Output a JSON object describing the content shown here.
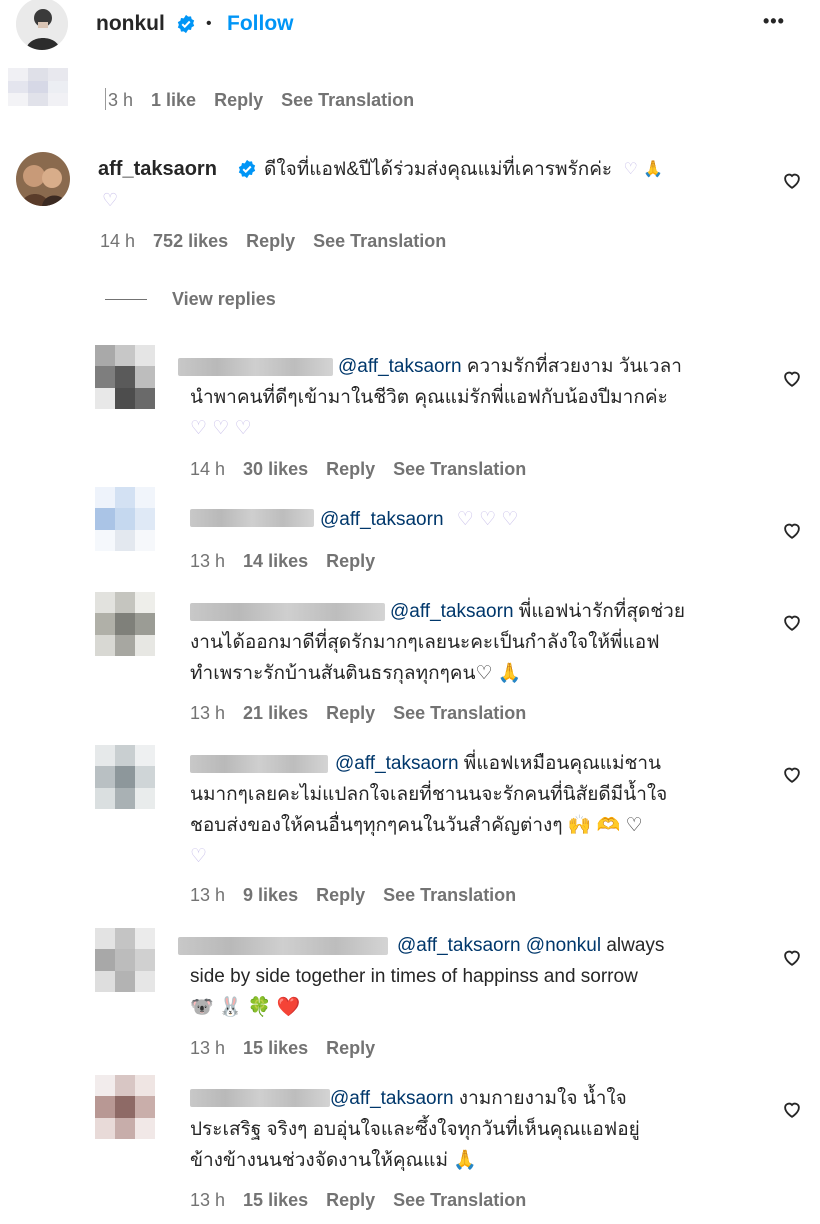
{
  "header": {
    "username": "nonkul",
    "separator": "•",
    "follow_label": "Follow",
    "more_label": "•••"
  },
  "top_comment": {
    "time": "3 h",
    "likes": "1 like",
    "reply": "Reply",
    "translate": "See Translation"
  },
  "main_comment": {
    "username": "aff_taksaorn",
    "text": "ดีใจที่แอฟ&ปีได้ร่วมส่งคุณแม่ที่เคารพรักค่ะ",
    "emoji1": "♡",
    "emoji2": "🙏",
    "emoji3": "♡",
    "time": "14 h",
    "likes": "752 likes",
    "reply": "Reply",
    "translate": "See Translation",
    "view_replies": "View replies"
  },
  "replies": [
    {
      "mention": "@aff_taksaorn",
      "line1": "ความรักที่สวยงาม วันเวลา",
      "line2": "นำพาคนที่ดีๆเข้ามาในชีวิต คุณแม่รักพี่แอฟกับน้องปีมากค่ะ",
      "line3": "♡ ♡ ♡",
      "time": "14 h",
      "likes": "30 likes",
      "reply": "Reply",
      "translate": "See Translation"
    },
    {
      "mention": "@aff_taksaorn",
      "line1": "♡ ♡ ♡",
      "time": "13 h",
      "likes": "14 likes",
      "reply": "Reply"
    },
    {
      "mention": "@aff_taksaorn",
      "line1": "พี่แอฟน่ารักที่สุดช่วย",
      "line2": "งานได้ออกมาดีที่สุดรักมากๆเลยนะคะเป็นกำลังใจให้พี่แอฟ",
      "line3": "ทำเพราะรักบ้านสันตินธรกุลทุกๆคน♡ 🙏",
      "time": "13 h",
      "likes": "21 likes",
      "reply": "Reply",
      "translate": "See Translation"
    },
    {
      "mention": "@aff_taksaorn",
      "line1": "พี่แอฟเหมือนคุณแม่ชาน",
      "line2": "นมากๆเลยคะไม่แปลกใจเลยที่ชานนจะรักคนที่นิสัยดีมีน้ำใจ",
      "line3": "ชอบส่งของให้คนอื่นๆทุกๆคนในวันสำคัญต่างๆ 🙌 🫶 ♡",
      "line4": "♡",
      "time": "13 h",
      "likes": "9 likes",
      "reply": "Reply",
      "translate": "See Translation"
    },
    {
      "mention": "@aff_taksaorn @nonkul",
      "line1": "always",
      "line2": "side by side together in times of happinss and sorrow",
      "line3": "🐨 🐰 🍀 ❤️",
      "time": "13 h",
      "likes": "15 likes",
      "reply": "Reply"
    },
    {
      "mention": "@aff_taksaorn",
      "line1": "งามกายงามใจ น้ำใจ",
      "line2": "ประเสริฐ จริงๆ อบอุ่นใจและซึ้งใจทุกวันที่เห็นคุณแอฟอยู่",
      "line3": "ข้างข้างนนช่วงจัดงานให้คุณแม่ 🙏",
      "time": "13 h",
      "likes": "15 likes",
      "reply": "Reply",
      "translate": "See Translation"
    }
  ],
  "colors": {
    "link": "#0095f6",
    "mention": "#00376b",
    "meta": "#737373",
    "verified": "#0095f6"
  }
}
